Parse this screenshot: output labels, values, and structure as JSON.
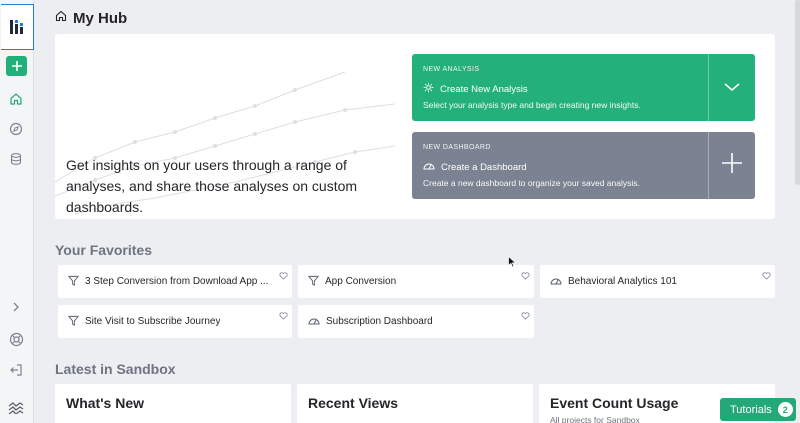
{
  "header": {
    "title": "My Hub"
  },
  "hero": {
    "text": "Get insights on your users through a range of analyses, and share those analyses on custom dashboards.",
    "analysis": {
      "kicker": "NEW ANALYSIS",
      "title": "Create New Analysis",
      "description": "Select your analysis type and begin creating new insights.",
      "color": "#24b07a"
    },
    "dashboard": {
      "kicker": "NEW DASHBOARD",
      "title": "Create a Dashboard",
      "description": "Create a new dashboard to organize your saved analysis.",
      "color": "#7b8291"
    }
  },
  "favorites": {
    "title": "Your Favorites",
    "items": [
      {
        "label": "3 Step Conversion from Download App ...",
        "icon": "funnel-icon"
      },
      {
        "label": "App Conversion",
        "icon": "funnel-icon"
      },
      {
        "label": "Behavioral Analytics 101",
        "icon": "dashboard-icon"
      },
      {
        "label": "Site Visit to Subscribe Journey",
        "icon": "funnel-icon"
      },
      {
        "label": "Subscription Dashboard",
        "icon": "dashboard-icon"
      }
    ]
  },
  "latest": {
    "title": "Latest in Sandbox",
    "cards": [
      {
        "title": "What's New",
        "subtitle": ""
      },
      {
        "title": "Recent Views",
        "subtitle": ""
      },
      {
        "title": "Event Count Usage",
        "subtitle": "All projects for Sandbox"
      }
    ]
  },
  "tutorials": {
    "label": "Tutorials",
    "count": "2",
    "color": "#24a877"
  },
  "rail": {
    "icons": [
      "logo-icon",
      "add-icon",
      "home-icon",
      "compass-icon",
      "database-icon",
      "chevron-right-icon",
      "help-icon",
      "logout-icon",
      "brand-icon"
    ]
  }
}
